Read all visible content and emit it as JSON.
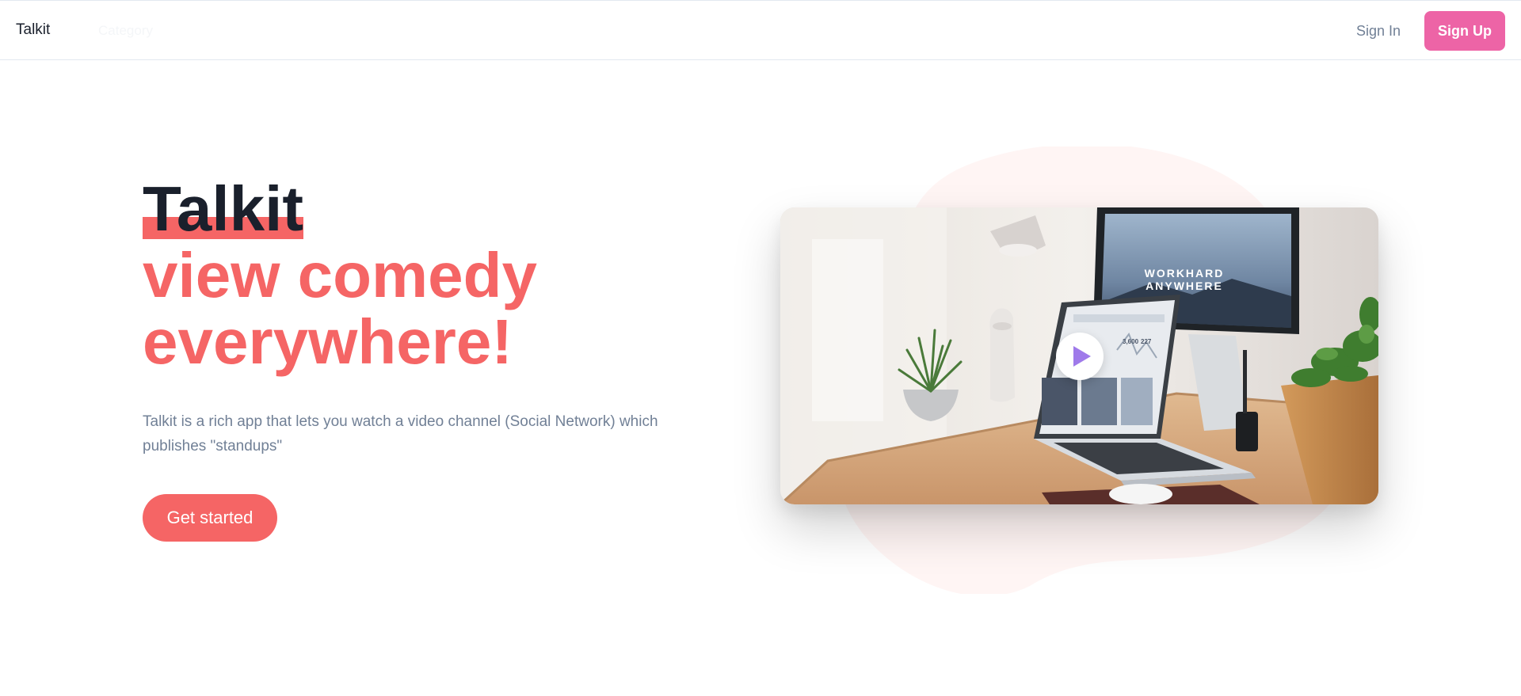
{
  "nav": {
    "brand": "Talkit",
    "categories": "Category",
    "sign_in": "Sign In",
    "sign_up": "Sign Up"
  },
  "hero": {
    "title_line1": "Talkit",
    "title_line2": "view comedy",
    "title_line3": "everywhere!",
    "description": "Talkit is a rich app that lets you watch a video channel (Social Network) which publishes \"standups\"",
    "cta": "Get started"
  },
  "video": {
    "screen_caption_line1": "WORKHARD",
    "screen_caption_line2": "ANYWHERE",
    "laptop_stat1": "3,600",
    "laptop_stat2": "227"
  },
  "colors": {
    "accent": "#f56565",
    "signup": "#ed64a6",
    "heading": "#1a202c",
    "muted": "#718096",
    "play_icon": "#9f7aea",
    "blob": "#fff5f4"
  },
  "icons": {
    "play": "play-icon"
  }
}
